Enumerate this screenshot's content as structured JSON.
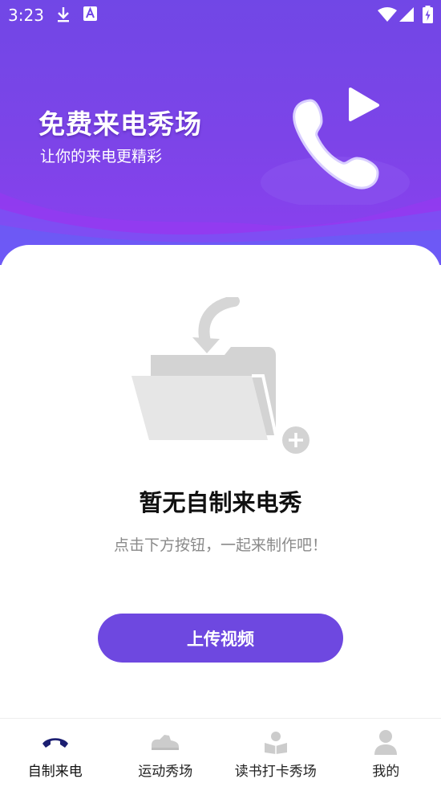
{
  "status_bar": {
    "time": "3:23",
    "left_icons": [
      "download-icon",
      "app-notification-icon"
    ],
    "right_icons": [
      "wifi-icon",
      "signal-icon",
      "battery-icon"
    ]
  },
  "banner": {
    "title": "免费来电秀场",
    "subtitle": "让你的来电更精彩",
    "icon": "phone-play-icon"
  },
  "empty_state": {
    "icon": "empty-folder-icon",
    "title": "暂无自制来电秀",
    "subtitle": "点击下方按钮，一起来制作吧！"
  },
  "upload_button": {
    "label": "上传视频"
  },
  "tabs": [
    {
      "label": "自制来电",
      "icon": "phone-icon",
      "active": true
    },
    {
      "label": "运动秀场",
      "icon": "sneaker-icon",
      "active": false
    },
    {
      "label": "读书打卡秀场",
      "icon": "reading-icon",
      "active": false
    },
    {
      "label": "我的",
      "icon": "profile-icon",
      "active": false
    }
  ],
  "colors": {
    "primary": "#6e48e0",
    "header_top": "#7147e6",
    "header_bottom": "#8c3ff0",
    "tab_active_icon": "#1c1f72",
    "tab_inactive_icon": "#c9c9c9"
  }
}
